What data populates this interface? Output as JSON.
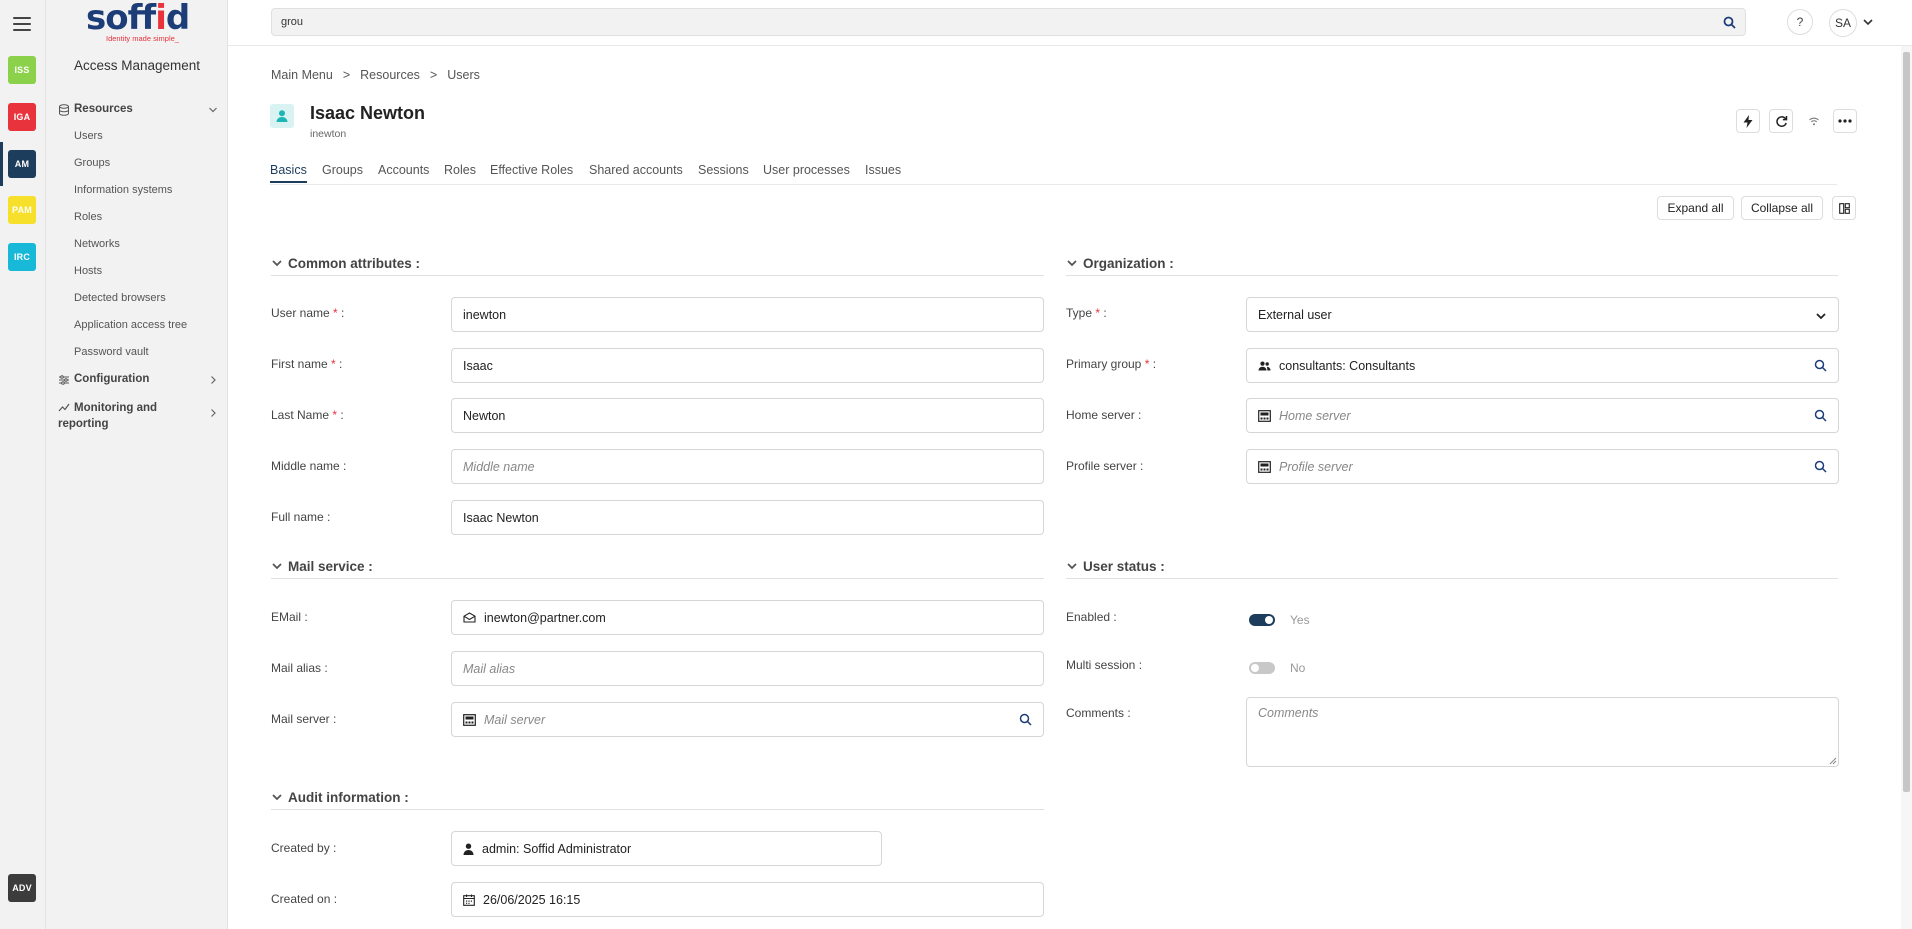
{
  "rail": {
    "apps": [
      {
        "label": "ISS",
        "color": "#8bd14a"
      },
      {
        "label": "IGA",
        "color": "#e8323c"
      },
      {
        "label": "AM",
        "color": "#1d3d5c"
      },
      {
        "label": "PAM",
        "color": "#f6e02c"
      },
      {
        "label": "IRC",
        "color": "#17b8d8"
      }
    ],
    "adv": {
      "label": "ADV",
      "color": "#3c3c3c"
    }
  },
  "sidebar": {
    "logo_text": "soffid",
    "logo_tagline": "Identity made simple_",
    "module_title": "Access Management",
    "resources": {
      "label": "Resources",
      "items": [
        "Users",
        "Groups",
        "Information systems",
        "Roles",
        "Networks",
        "Hosts",
        "Detected browsers",
        "Application access tree",
        "Password vault"
      ]
    },
    "configuration": {
      "label": "Configuration"
    },
    "monitoring": {
      "label_line1": "Monitoring and",
      "label_line2": "reporting"
    }
  },
  "topbar": {
    "search_value": "grou",
    "help_label": "?",
    "avatar_initials": "SA"
  },
  "breadcrumb": {
    "items": [
      "Main Menu",
      "Resources",
      "Users"
    ],
    "separator": ">"
  },
  "header": {
    "title": "Isaac Newton",
    "subtitle": "inewton"
  },
  "tabs": [
    "Basics",
    "Groups",
    "Accounts",
    "Roles",
    "Effective Roles",
    "Shared accounts",
    "Sessions",
    "User processes",
    "Issues"
  ],
  "toolbar": {
    "expand_all": "Expand all",
    "collapse_all": "Collapse all"
  },
  "common": {
    "title": "Common attributes :",
    "fields": [
      {
        "label": "User name",
        "required": true,
        "value": "inewton",
        "placeholder": ""
      },
      {
        "label": "First name",
        "required": true,
        "value": "Isaac",
        "placeholder": ""
      },
      {
        "label": "Last Name",
        "required": true,
        "value": "Newton",
        "placeholder": ""
      },
      {
        "label": "Middle name",
        "required": false,
        "value": "",
        "placeholder": "Middle name"
      },
      {
        "label": "Full name",
        "required": false,
        "value": "Isaac Newton",
        "placeholder": ""
      }
    ]
  },
  "organization": {
    "title": "Organization :",
    "type": {
      "label": "Type",
      "value": "External user"
    },
    "primary_group": {
      "label": "Primary group",
      "value": "consultants: Consultants"
    },
    "home_server": {
      "label": "Home server :",
      "placeholder": "Home server"
    },
    "profile_server": {
      "label": "Profile server :",
      "placeholder": "Profile server"
    }
  },
  "mail": {
    "title": "Mail service :",
    "email": {
      "label": "EMail :",
      "value": "inewton@partner.com"
    },
    "alias": {
      "label": "Mail alias :",
      "placeholder": "Mail alias"
    },
    "server": {
      "label": "Mail server :",
      "placeholder": "Mail server"
    }
  },
  "status": {
    "title": "User status :",
    "enabled": {
      "label": "Enabled :",
      "value": "Yes",
      "on": true
    },
    "multi_session": {
      "label": "Multi session :",
      "value": "No",
      "on": false
    },
    "comments": {
      "label": "Comments :",
      "placeholder": "Comments"
    }
  },
  "audit": {
    "title": "Audit information :",
    "created_by": {
      "label": "Created by :",
      "value": "admin: Soffid Administrator"
    },
    "created_on": {
      "label": "Created on :",
      "value": "26/06/2025 16:15"
    }
  }
}
